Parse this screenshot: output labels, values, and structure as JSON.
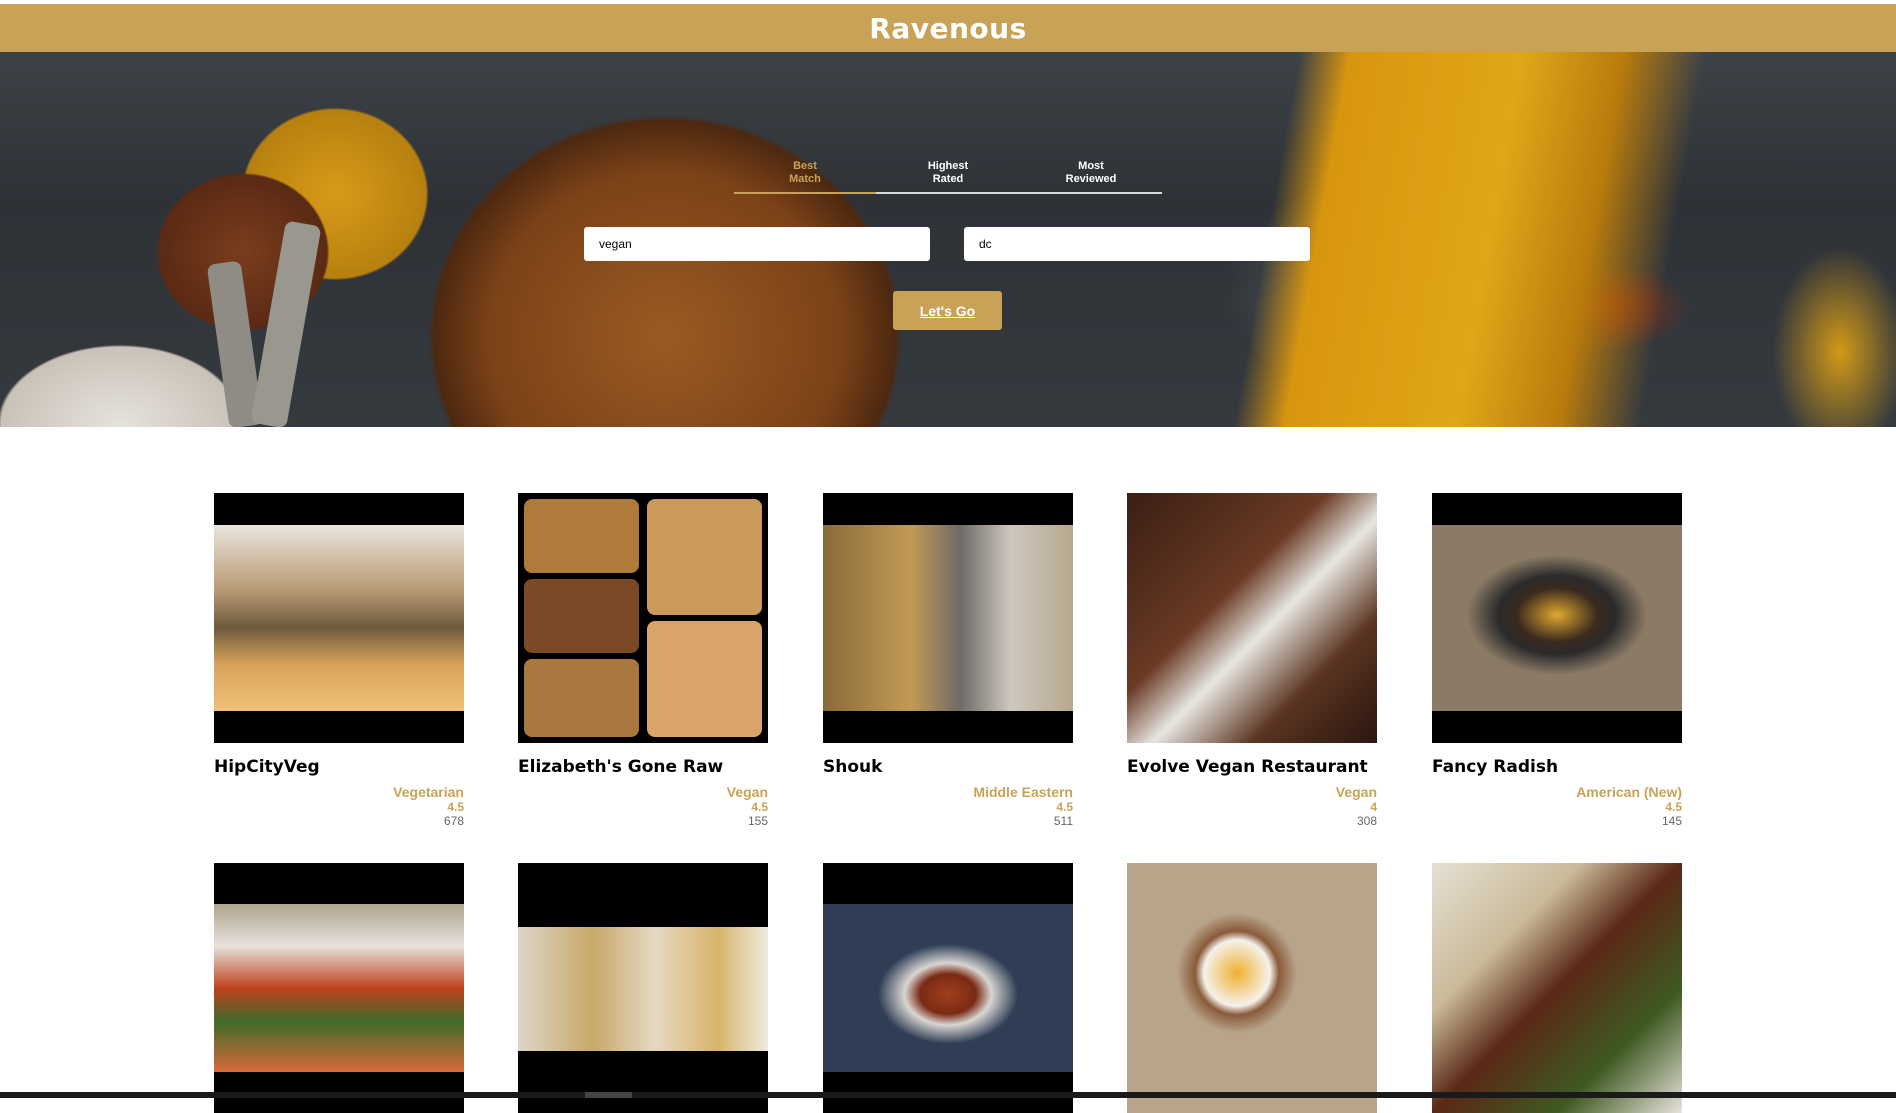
{
  "app": {
    "title": "Ravenous"
  },
  "colors": {
    "accent": "#c8a256",
    "header_text": "#ffffff"
  },
  "sort_tabs": [
    {
      "label_line1": "Best",
      "label_line2": "Match",
      "active": true
    },
    {
      "label_line1": "Highest",
      "label_line2": "Rated",
      "active": false
    },
    {
      "label_line1": "Most",
      "label_line2": "Reviewed",
      "active": false
    }
  ],
  "search": {
    "term_value": "vegan",
    "location_value": "dc",
    "submit_label": "Let's Go"
  },
  "businesses": [
    {
      "name": "HipCityVeg",
      "category": "Vegetarian",
      "rating": "4.5",
      "reviews": "678"
    },
    {
      "name": "Elizabeth's Gone Raw",
      "category": "Vegan",
      "rating": "4.5",
      "reviews": "155"
    },
    {
      "name": "Shouk",
      "category": "Middle Eastern",
      "rating": "4.5",
      "reviews": "511"
    },
    {
      "name": "Evolve Vegan Restaurant",
      "category": "Vegan",
      "rating": "4",
      "reviews": "308"
    },
    {
      "name": "Fancy Radish",
      "category": "American (New)",
      "rating": "4.5",
      "reviews": "145"
    },
    {
      "name": "",
      "category": "",
      "rating": "",
      "reviews": ""
    },
    {
      "name": "",
      "category": "",
      "rating": "",
      "reviews": ""
    },
    {
      "name": "",
      "category": "",
      "rating": "",
      "reviews": ""
    },
    {
      "name": "",
      "category": "",
      "rating": "",
      "reviews": ""
    },
    {
      "name": "",
      "category": "",
      "rating": "",
      "reviews": ""
    }
  ]
}
